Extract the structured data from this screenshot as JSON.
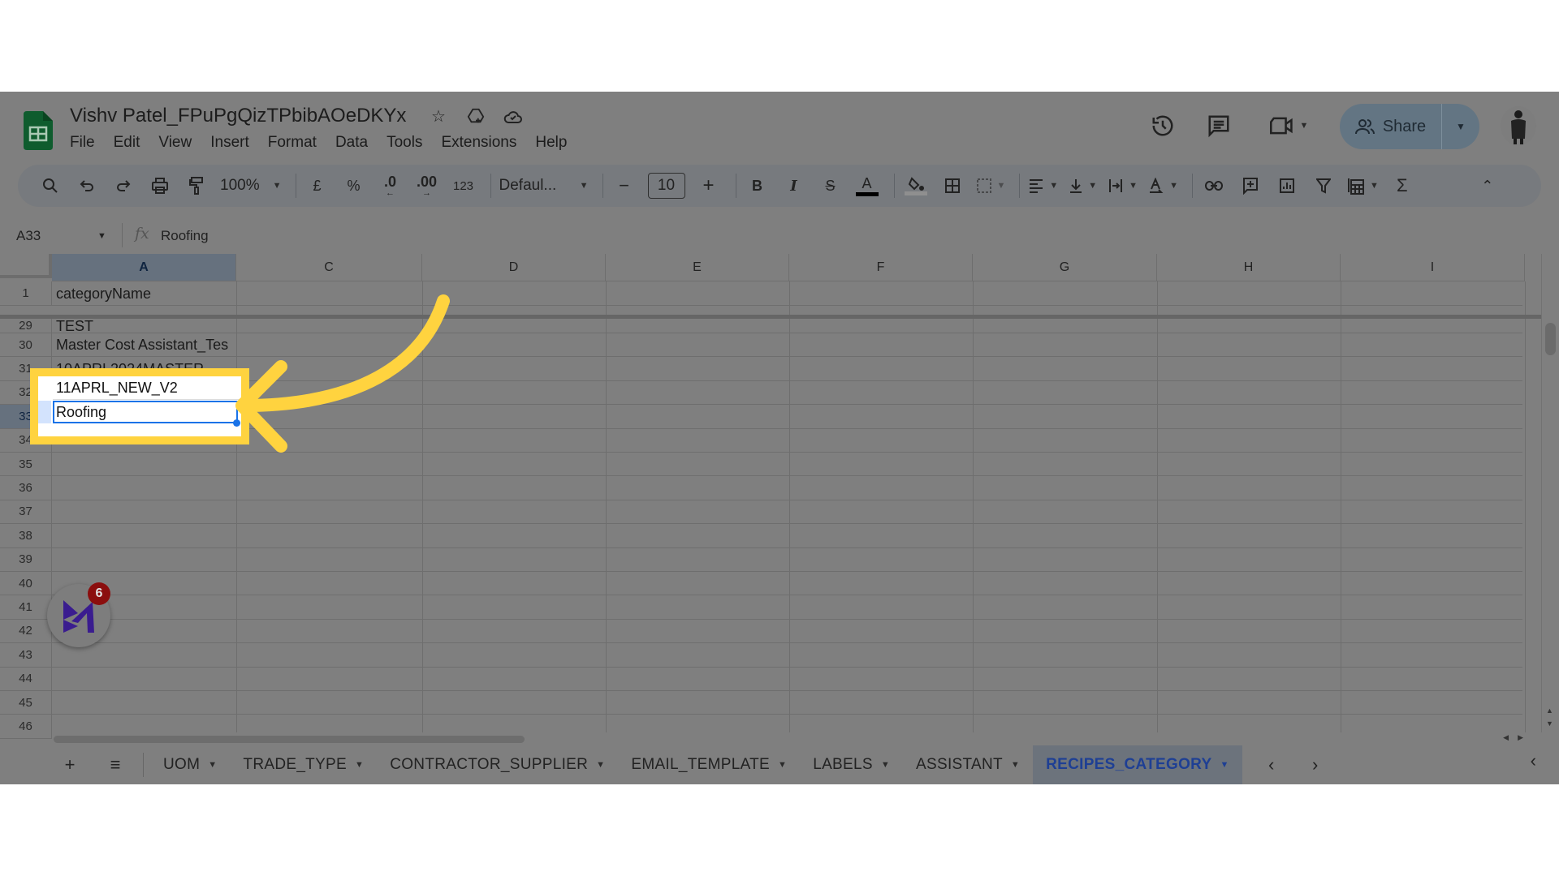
{
  "document": {
    "title": "Vishv Patel_FPuPgQizTPbibAOeDKYx",
    "title_icons": [
      "star-icon",
      "move-to-drive-icon",
      "cloud-saved-icon"
    ]
  },
  "menu": [
    "File",
    "Edit",
    "View",
    "Insert",
    "Format",
    "Data",
    "Tools",
    "Extensions",
    "Help"
  ],
  "header_right": {
    "share_label": "Share",
    "icons": [
      "version-history-icon",
      "comments-icon",
      "meet-icon"
    ]
  },
  "toolbar": {
    "zoom": "100%",
    "currency": "£",
    "percent": "%",
    "decrease_decimal": ".0",
    "increase_decimal": ".00",
    "number_format": "123",
    "font": "Defaul...",
    "font_size": "10",
    "minus": "−",
    "plus": "+"
  },
  "formula_bar": {
    "name_box": "A33",
    "fx": "fx",
    "formula": "Roofing"
  },
  "columns": [
    "A",
    "C",
    "D",
    "E",
    "F",
    "G",
    "H",
    "I"
  ],
  "selected_column": "A",
  "frozen_row": {
    "row": "1",
    "value": "categoryName"
  },
  "rows": [
    {
      "row": "29",
      "value": "TEST"
    },
    {
      "row": "30",
      "value": "Master Cost Assistant_Tes"
    },
    {
      "row": "31",
      "value": "10APRL2024MASTER"
    },
    {
      "row": "32",
      "value": "11APRL_NEW_V2"
    },
    {
      "row": "33",
      "value": "Roofing"
    },
    {
      "row": "34",
      "value": ""
    },
    {
      "row": "35",
      "value": ""
    },
    {
      "row": "36",
      "value": ""
    },
    {
      "row": "37",
      "value": ""
    },
    {
      "row": "38",
      "value": ""
    },
    {
      "row": "39",
      "value": ""
    },
    {
      "row": "40",
      "value": ""
    },
    {
      "row": "41",
      "value": ""
    },
    {
      "row": "42",
      "value": ""
    },
    {
      "row": "43",
      "value": ""
    },
    {
      "row": "44",
      "value": ""
    },
    {
      "row": "45",
      "value": ""
    },
    {
      "row": "46",
      "value": ""
    }
  ],
  "selected_cell": "A33",
  "sheet_tabs": [
    {
      "label": "UOM",
      "active": false
    },
    {
      "label": "TRADE_TYPE",
      "active": false
    },
    {
      "label": "CONTRACTOR_SUPPLIER",
      "active": false
    },
    {
      "label": "EMAIL_TEMPLATE",
      "active": false
    },
    {
      "label": "LABELS",
      "active": false
    },
    {
      "label": "ASSISTANT",
      "active": false
    },
    {
      "label": "RECIPES_CATEGORY",
      "active": true
    }
  ],
  "floating_badge": {
    "count": "6"
  },
  "colors": {
    "highlight": "#ffd33f",
    "selection": "#1a73e8",
    "overlay": "#7f7f7f",
    "active_tab_text": "#1e3f94",
    "badge": "#8b0e0e",
    "brand_m": "#3a1c8f"
  }
}
